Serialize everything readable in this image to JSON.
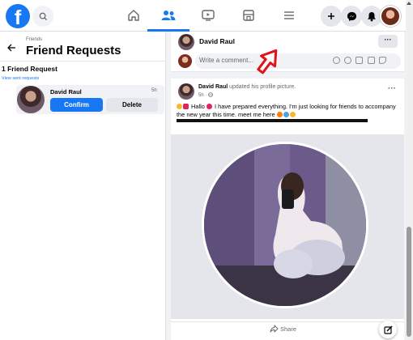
{
  "topbar": {
    "logo_letter": "f",
    "icons": {
      "search": "search-icon",
      "home": "home-icon",
      "friends": "friends-icon",
      "watch": "video-icon",
      "marketplace": "marketplace-icon",
      "menu": "menu-icon",
      "create": "plus-icon",
      "messenger": "messenger-icon",
      "notifications": "bell-icon"
    },
    "active_tab": "friends"
  },
  "left_panel": {
    "breadcrumb": "Friends",
    "title": "Friend Requests",
    "request_count": "1 Friend Request",
    "sent_link": "View sent requests",
    "request": {
      "name": "David Raul",
      "time": "5h",
      "confirm_label": "Confirm",
      "delete_label": "Delete"
    }
  },
  "profile_view": {
    "name": "David Raul",
    "more_label": "···",
    "comment_placeholder": "Write a comment..."
  },
  "post": {
    "author": "David Raul",
    "action": " updated his profile picture.",
    "meta": "5h · ",
    "more_label": "···",
    "text_pre": " Hallo ",
    "text_main": " I have prepared everything. I'm just looking for friends to accompany the new year this time. meet me here ",
    "share_label": "Share"
  },
  "colors": {
    "brand": "#1877f2",
    "annotation_arrow": "#e0121b"
  }
}
